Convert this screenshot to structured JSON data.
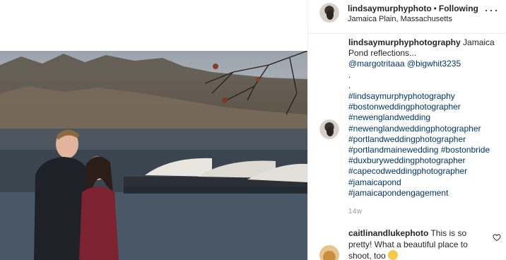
{
  "post": {
    "photo_alt": "Couple standing in front of Jamaica Pond"
  },
  "header": {
    "username": "lindsaymurphyphoto",
    "separator": "•",
    "follow_label": "Following",
    "location": "Jamaica Plain, Massachusetts",
    "more_icon": "more-options-icon"
  },
  "caption": {
    "username": "lindsaymurphyphotography",
    "text": "Jamaica Pond reflections...",
    "mention1": "@margotritaaa",
    "mention2": "@bigwhit3235",
    "dot1": ".",
    "dot2": ".",
    "tags": [
      "#lindsaymurphyphotography",
      "#bostonweddingphotographer",
      "#newenglandwedding",
      "#newenglandweddingphotographer",
      "#portlandweddingphotographer",
      "#portlandmainewedding #bostonbride",
      "#duxburyweddingphotographer",
      "#capecodweddingphotographer",
      "#jamaicapond",
      "#jamaicapondengagement"
    ],
    "time": "14w"
  },
  "comment": {
    "username": "caitlinandlukephoto",
    "text": "This is so pretty! What a beautiful place to shoot, too"
  },
  "colors": {
    "link": "#003569",
    "text": "#262626",
    "muted": "#999999",
    "border": "#efefef"
  }
}
